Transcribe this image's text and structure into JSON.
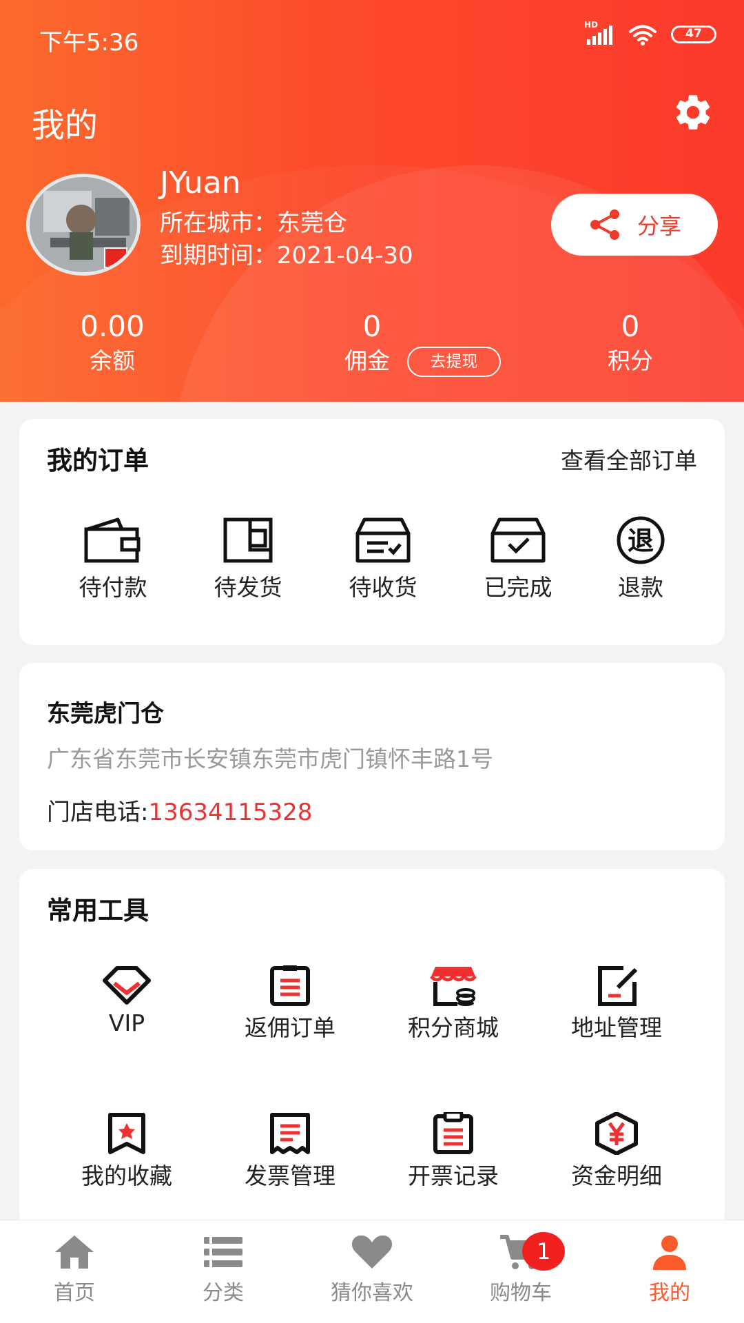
{
  "status_bar": {
    "time": "下午5:36",
    "network": "HD",
    "battery": "47"
  },
  "header": {
    "title": "我的"
  },
  "profile": {
    "name": "JYuan",
    "city": "所在城市：东莞仓",
    "expiry": "到期时间：2021-04-30",
    "share_label": "分享"
  },
  "stats": {
    "balance": {
      "value": "0.00",
      "label": "余额"
    },
    "commission": {
      "value": "0",
      "label": "佣金",
      "withdraw_label": "去提现"
    },
    "points": {
      "value": "0",
      "label": "积分"
    }
  },
  "orders": {
    "title": "我的订单",
    "view_all": "查看全部订单",
    "items": [
      {
        "label": "待付款",
        "icon": "wallet-icon"
      },
      {
        "label": "待发货",
        "icon": "package-icon"
      },
      {
        "label": "待收货",
        "icon": "inbox-icon"
      },
      {
        "label": "已完成",
        "icon": "box-check-icon"
      },
      {
        "label": "退款",
        "icon": "refund-icon"
      }
    ]
  },
  "store": {
    "name": "东莞虎门仓",
    "address": "广东省东莞市长安镇东莞市虎门镇怀丰路1号",
    "phone_label": "门店电话:",
    "phone": "13634115328"
  },
  "tools": {
    "title": "常用工具",
    "items": [
      {
        "label": "VIP",
        "icon": "diamond-icon"
      },
      {
        "label": "返佣订单",
        "icon": "clipboard-icon"
      },
      {
        "label": "积分商城",
        "icon": "shop-icon"
      },
      {
        "label": "地址管理",
        "icon": "edit-note-icon"
      },
      {
        "label": "我的收藏",
        "icon": "bookmark-icon"
      },
      {
        "label": "发票管理",
        "icon": "receipt-icon"
      },
      {
        "label": "开票记录",
        "icon": "clipboard-list-icon"
      },
      {
        "label": "资金明细",
        "icon": "yen-shield-icon"
      }
    ]
  },
  "tabbar": {
    "items": [
      {
        "label": "首页",
        "icon": "home-icon"
      },
      {
        "label": "分类",
        "icon": "list-icon"
      },
      {
        "label": "猜你喜欢",
        "icon": "heart-icon"
      },
      {
        "label": "购物车",
        "icon": "cart-icon"
      },
      {
        "label": "我的",
        "icon": "user-icon"
      }
    ],
    "active": "我的",
    "cart_badge": "1"
  },
  "colors": {
    "accent": "#fc4a2b",
    "phone": "#ee3030",
    "tab_active": "#fb5a2a",
    "tab_inactive": "#8a8a8a"
  }
}
